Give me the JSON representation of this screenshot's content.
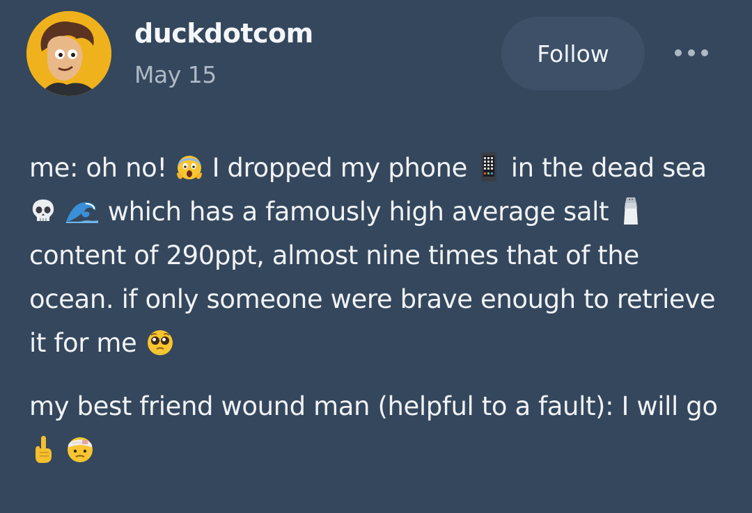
{
  "post": {
    "username": "duckdotcom",
    "date": "May 15",
    "follow_label": "Follow",
    "paragraph1": {
      "s1": "me: oh no!",
      "s2": "I dropped my phone",
      "s3": "in the dead sea",
      "s4": "which has a famously high average salt",
      "s5": "content of 290ppt, almost nine times that of the ocean. if only someone were brave enough to retrieve it for me"
    },
    "paragraph2": {
      "s1": "my best friend wound man (helpful to a fault): I will go"
    },
    "icons": {
      "e1": "screaming-face-emoji",
      "e2": "mobile-phone-emoji",
      "e3": "skull-emoji",
      "e4": "water-wave-emoji",
      "e5": "salt-shaker-emoji",
      "e6": "pleading-face-emoji",
      "e7": "index-pointing-up-emoji",
      "e8": "face-with-head-bandage-emoji"
    }
  }
}
